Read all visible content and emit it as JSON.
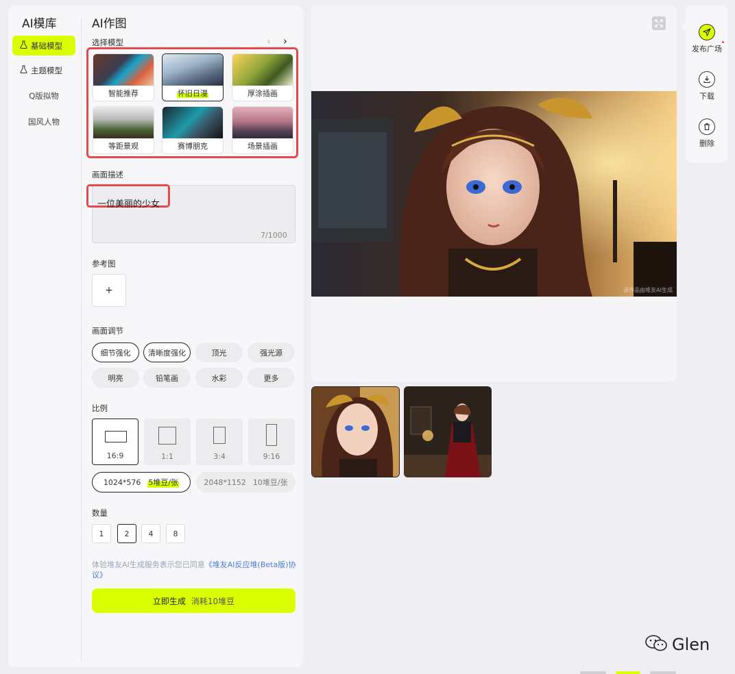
{
  "sidebar": {
    "title": "AI模库",
    "items": [
      {
        "label": "基础模型",
        "icon": "flask-icon",
        "active": true
      },
      {
        "label": "主题模型",
        "icon": "flask-icon",
        "active": false
      },
      {
        "label": "Q版拟物"
      },
      {
        "label": "国风人物"
      }
    ]
  },
  "form": {
    "title": "AI作图",
    "model_section_label": "选择模型",
    "models": [
      {
        "label": "智能推荐"
      },
      {
        "label": "怀旧日漫",
        "selected": true
      },
      {
        "label": "厚涂插画"
      },
      {
        "label": "等距景观"
      },
      {
        "label": "赛博朋克"
      },
      {
        "label": "场景插画"
      }
    ],
    "desc_label": "画面描述",
    "desc_value": "一位美丽的少女",
    "desc_count": "7/1000",
    "ref_label": "参考图",
    "ref_add": "+",
    "adjust_label": "画面调节",
    "adjust_chips": [
      {
        "label": "细节强化",
        "on": true
      },
      {
        "label": "清晰度强化",
        "on": true
      },
      {
        "label": "顶光",
        "on": false
      },
      {
        "label": "强光源",
        "on": false
      },
      {
        "label": "明亮",
        "on": false
      },
      {
        "label": "铅笔画",
        "on": false
      },
      {
        "label": "水彩",
        "on": false
      },
      {
        "label": "更多",
        "on": false
      }
    ],
    "ratio_label": "比例",
    "ratios": [
      {
        "label": "16:9",
        "on": true
      },
      {
        "label": "1:1",
        "on": false
      },
      {
        "label": "3:4",
        "on": false
      },
      {
        "label": "9:16",
        "on": false
      }
    ],
    "resolutions": [
      {
        "size": "1024*576",
        "cost": "5堆豆/张",
        "on": true
      },
      {
        "size": "2048*1152",
        "cost": "10堆豆/张",
        "on": false
      }
    ],
    "qty_label": "数量",
    "quantities": [
      {
        "label": "1",
        "on": false
      },
      {
        "label": "2",
        "on": true
      },
      {
        "label": "4",
        "on": false
      },
      {
        "label": "8",
        "on": false
      }
    ],
    "agreement_text": "体验堆友AI生成服务表示您已同意",
    "agreement_link": "《堆友AI反应堆(Beta版)协议》",
    "generate_label": "立即生成",
    "generate_cost": "消耗10堆豆"
  },
  "preview": {
    "watermark": "该作品由堆友AI生成",
    "expand_icon": "expand-icon"
  },
  "actions": [
    {
      "label": "发布广场",
      "icon": "send-icon"
    },
    {
      "label": "下载",
      "icon": "download-icon"
    },
    {
      "label": "删除",
      "icon": "trash-icon"
    }
  ],
  "brand": {
    "name": "Glen",
    "icon": "wechat-icon"
  },
  "colors": {
    "accent": "#d9ff00",
    "highlight_red": "#e5484d",
    "link": "#4b7bd6"
  }
}
